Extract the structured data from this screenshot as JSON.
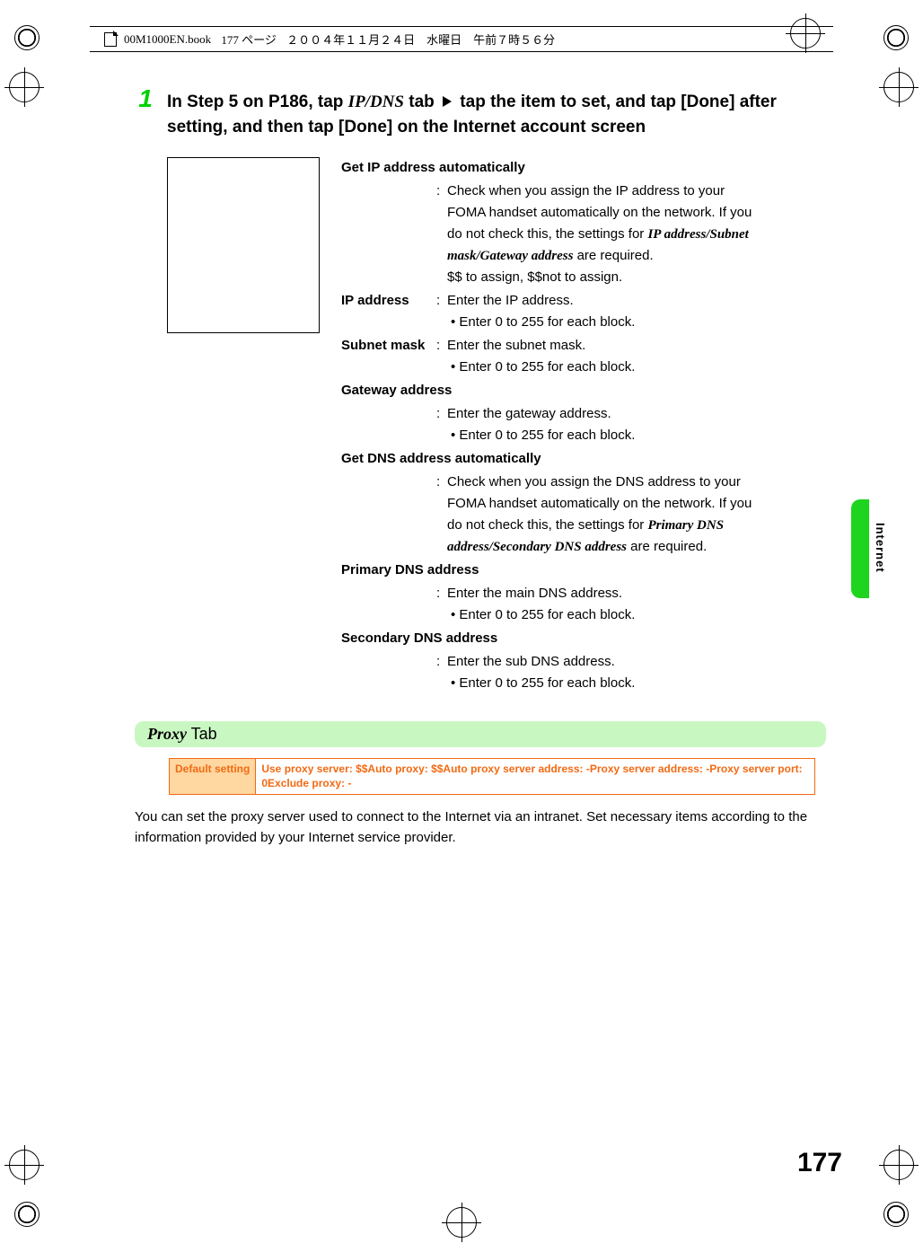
{
  "header": {
    "filename": "00M1000EN.book",
    "page": "177 ページ",
    "date": "２００４年１１月２４日　水曜日　午前７時５６分"
  },
  "step": {
    "number": "1",
    "line1_a": "In Step 5 on P186, tap ",
    "line1_b": "IP/DNS",
    "line1_c": " tab ",
    "line1_d": " tap the item to set, and tap [Done] after setting, and then tap [Done] on the Internet account screen"
  },
  "defs": {
    "get_ip_auto_term": "Get IP address automatically",
    "get_ip_auto_desc1": "Check when you assign the IP address to your FOMA handset automatically on the network. If you do not check this, the settings for ",
    "get_ip_auto_desc_italic": "IP address/Subnet mask/Gateway address",
    "get_ip_auto_desc2": " are required.",
    "get_ip_auto_desc3": "$$ to assign, $$not to assign.",
    "ip_term": "IP address",
    "ip_desc": "Enter the IP address.",
    "ip_bullet": "Enter 0 to 255 for each block.",
    "subnet_term": "Subnet mask",
    "subnet_desc": "Enter the subnet mask.",
    "subnet_bullet": "Enter 0 to 255 for each block.",
    "gateway_term": "Gateway address",
    "gateway_desc": "Enter the gateway address.",
    "gateway_bullet": "Enter 0 to 255 for each block.",
    "get_dns_term": "Get DNS address automatically",
    "get_dns_desc1": "Check when you assign the DNS address to your FOMA handset automatically on the network. If you do not check this, the settings for ",
    "get_dns_italic": "Primary DNS address/Secondary DNS address",
    "get_dns_desc2": " are required.",
    "pri_dns_term": "Primary DNS address",
    "pri_dns_desc": "Enter the main DNS address.",
    "pri_dns_bullet": "Enter 0 to 255 for each block.",
    "sec_dns_term": "Secondary DNS address",
    "sec_dns_desc": "Enter the sub DNS address.",
    "sec_dns_bullet": "Enter 0 to 255 for each block."
  },
  "proxy": {
    "heading_italic": "Proxy",
    "heading_rest": " Tab",
    "default_label": "Default setting",
    "default_value": "Use proxy server: $$Auto proxy: $$Auto proxy server address: -Proxy server address: -Proxy server port: 0Exclude proxy: -",
    "desc": "You can set the proxy server used to connect to the Internet via an intranet. Set necessary items according to the information provided by your Internet service provider."
  },
  "side_label": "Internet",
  "page_number": "177"
}
